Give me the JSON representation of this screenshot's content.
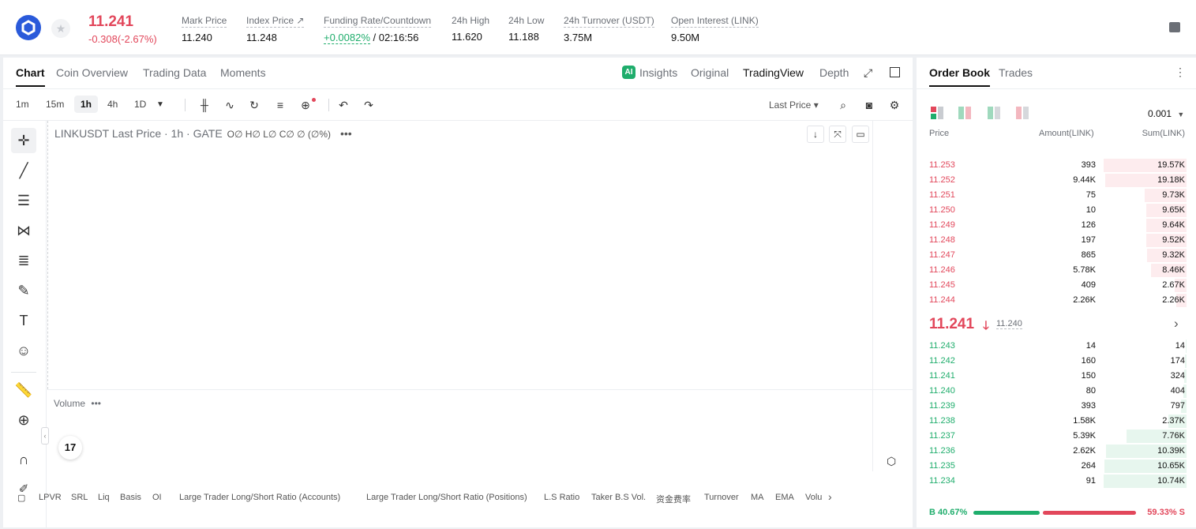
{
  "ticker": {
    "last_price": "11.241",
    "change": "-0.308(-2.67%)",
    "stats": [
      {
        "label": "Mark Price",
        "value": "11.240"
      },
      {
        "label": "Index Price ↗",
        "value": "11.248"
      },
      {
        "label": "Funding Rate/Countdown",
        "value_rate": "+0.0082%",
        "value_countdown": "/ 02:16:56"
      },
      {
        "label": "24h High",
        "value": "11.620"
      },
      {
        "label": "24h Low",
        "value": "11.188"
      },
      {
        "label": "24h Turnover (USDT)",
        "value": "3.75M"
      },
      {
        "label": "Open Interest (LINK)",
        "value": "9.50M"
      }
    ]
  },
  "chart_tabs": [
    "Chart",
    "Coin Overview",
    "Trading Data",
    "Moments"
  ],
  "view_tabs": {
    "insights": "Insights",
    "original": "Original",
    "tradingview": "TradingView",
    "depth": "Depth"
  },
  "timeframes": [
    "1m",
    "15m",
    "1h",
    "4h",
    "1D"
  ],
  "price_source": "Last Price",
  "legend": {
    "symbol": "LINKUSDT Last Price · 1h · GATE",
    "ohlc": "O∅ H∅ L∅ C∅ ∅ (∅%)"
  },
  "volume_label": "Volume",
  "tv_logo": "17",
  "indicators": [
    "LPVR",
    "SRL",
    "Liq",
    "Basis",
    "OI",
    "Large Trader Long/Short Ratio (Accounts)",
    "Large Trader Long/Short Ratio (Positions)",
    "L.S Ratio",
    "Taker B.S Vol.",
    "资金费率",
    "Turnover",
    "MA",
    "EMA",
    "Volu"
  ],
  "order_book": {
    "tabs": [
      "Order Book",
      "Trades"
    ],
    "precision": "0.001",
    "columns": {
      "price": "Price",
      "amount": "Amount(LINK)",
      "sum": "Sum(LINK)"
    },
    "asks": [
      {
        "price": "11.253",
        "amount": "393",
        "sum": "19.57K",
        "depth": 1.0
      },
      {
        "price": "11.252",
        "amount": "9.44K",
        "sum": "19.18K",
        "depth": 0.98
      },
      {
        "price": "11.251",
        "amount": "75",
        "sum": "9.73K",
        "depth": 0.5
      },
      {
        "price": "11.250",
        "amount": "10",
        "sum": "9.65K",
        "depth": 0.49
      },
      {
        "price": "11.249",
        "amount": "126",
        "sum": "9.64K",
        "depth": 0.49
      },
      {
        "price": "11.248",
        "amount": "197",
        "sum": "9.52K",
        "depth": 0.49
      },
      {
        "price": "11.247",
        "amount": "865",
        "sum": "9.32K",
        "depth": 0.48
      },
      {
        "price": "11.246",
        "amount": "5.78K",
        "sum": "8.46K",
        "depth": 0.43
      },
      {
        "price": "11.245",
        "amount": "409",
        "sum": "2.67K",
        "depth": 0.14
      },
      {
        "price": "11.244",
        "amount": "2.26K",
        "sum": "2.26K",
        "depth": 0.12
      }
    ],
    "mid_price": "11.241",
    "mark_price": "11.240",
    "bids": [
      {
        "price": "11.243",
        "amount": "14",
        "sum": "14",
        "depth": 0.01
      },
      {
        "price": "11.242",
        "amount": "160",
        "sum": "174",
        "depth": 0.02
      },
      {
        "price": "11.241",
        "amount": "150",
        "sum": "324",
        "depth": 0.03
      },
      {
        "price": "11.240",
        "amount": "80",
        "sum": "404",
        "depth": 0.04
      },
      {
        "price": "11.239",
        "amount": "393",
        "sum": "797",
        "depth": 0.07
      },
      {
        "price": "11.238",
        "amount": "1.58K",
        "sum": "2.37K",
        "depth": 0.22
      },
      {
        "price": "11.237",
        "amount": "5.39K",
        "sum": "7.76K",
        "depth": 0.72
      },
      {
        "price": "11.236",
        "amount": "2.62K",
        "sum": "10.39K",
        "depth": 0.97
      },
      {
        "price": "11.235",
        "amount": "264",
        "sum": "10.65K",
        "depth": 0.99
      },
      {
        "price": "11.234",
        "amount": "91",
        "sum": "10.74K",
        "depth": 1.0
      }
    ],
    "buy_ratio": "B 40.67%",
    "sell_ratio": "59.33% S",
    "buy_fraction": 0.4067
  },
  "colors": {
    "ask": "#e2475b",
    "bid": "#1fad6c",
    "brand": "#2a5ada"
  }
}
